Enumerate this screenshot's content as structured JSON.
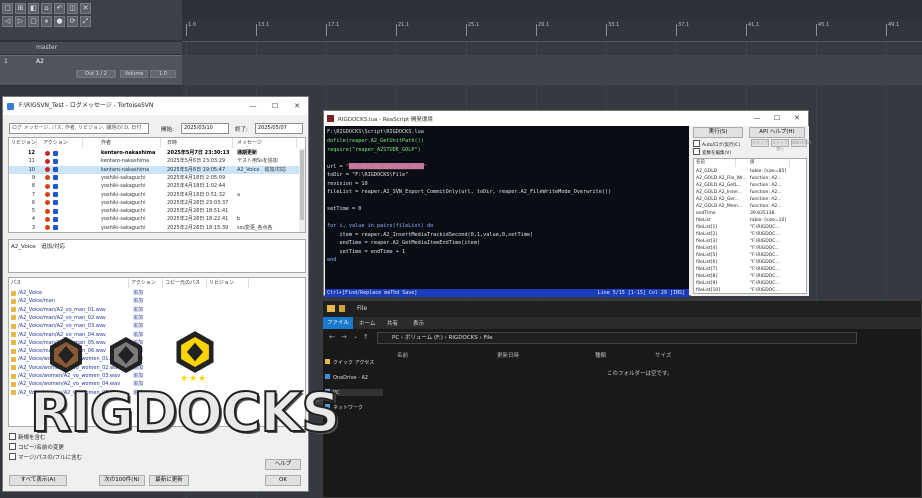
{
  "reaper": {
    "master_label": "master",
    "track_name": "A2",
    "track_btns": [
      "Out 1 / 2",
      "Volume",
      "1.0"
    ],
    "ruler_labels": [
      "1.0",
      "13.1",
      "17.1",
      "21.1",
      "25.1",
      "29.1",
      "33.1",
      "37.1",
      "41.1",
      "45.1",
      "49.1"
    ]
  },
  "tortoise": {
    "title": "F:\\RIGSVN_Test - ログメッセージ - TortoiseSVN",
    "search_placeholder": "ログ メッセージ, パス, 作者, リビジョン, 課題のI D, 日付",
    "from_label": "開始:",
    "from_date": "2025/03/10",
    "to_label": "終了:",
    "to_date": "2025/05/07",
    "columns": [
      "リビジョン",
      "アクション",
      "作者",
      "日時",
      "メッセージ"
    ],
    "rows": [
      {
        "rev": "12",
        "author": "kentaro-nakashima",
        "date": "2025年5月7日 23:30:13",
        "msg": "通期更新",
        "bold": true,
        "sel": false
      },
      {
        "rev": "11",
        "author": "kentaro-nakashima",
        "date": "2025年5月6日 23:03:29",
        "msg": "テスト用Ssを追加",
        "bold": false,
        "sel": false
      },
      {
        "rev": "10",
        "author": "kentaro-nakashima",
        "date": "2025年5月6日 19:05:47",
        "msg": "A2_Voice　追加/対応",
        "bold": false,
        "sel": true
      },
      {
        "rev": "9",
        "author": "yoshiki-sakaguchi",
        "date": "2025年4月18日 2:05:09",
        "msg": "",
        "bold": false,
        "sel": false
      },
      {
        "rev": "8",
        "author": "yoshiki-sakaguchi",
        "date": "2025年4月18日 1:02:44",
        "msg": "",
        "bold": false,
        "sel": false
      },
      {
        "rev": "7",
        "author": "yoshiki-sakaguchi",
        "date": "2025年4月18日 0:51:32",
        "msg": "a",
        "bold": false,
        "sel": false
      },
      {
        "rev": "6",
        "author": "yoshiki-sakaguchi",
        "date": "2025年2月28日 23:03:37",
        "msg": "",
        "bold": false,
        "sel": false
      },
      {
        "rev": "5",
        "author": "yoshiki-sakaguchi",
        "date": "2025年2月28日 18:51:41",
        "msg": "",
        "bold": false,
        "sel": false
      },
      {
        "rev": "4",
        "author": "yoshiki-sakaguchi",
        "date": "2025年2月28日 18:22:41",
        "msg": "b",
        "bold": false,
        "sel": false
      },
      {
        "rev": "3",
        "author": "yoshiki-sakaguchi",
        "date": "2025年2月28日 18:15:39",
        "msg": "sss変更_各点各",
        "bold": false,
        "sel": false
      }
    ],
    "message_text": "A2_Voice　追加/対応",
    "path_columns": [
      "パス",
      "アクション",
      "コピー元のパス",
      "リビジョン"
    ],
    "paths": [
      {
        "p": "/A2_Voice",
        "a": "追加"
      },
      {
        "p": "/A2_Voice/man",
        "a": "追加"
      },
      {
        "p": "/A2_Voice/man/A2_vo_man_01.wav",
        "a": "追加"
      },
      {
        "p": "/A2_Voice/man/A2_vo_man_02.wav",
        "a": "追加"
      },
      {
        "p": "/A2_Voice/man/A2_vo_man_03.wav",
        "a": "追加"
      },
      {
        "p": "/A2_Voice/man/A2_vo_man_04.wav",
        "a": "追加"
      },
      {
        "p": "/A2_Voice/man/A2_vo_man_05.wav",
        "a": "追加"
      },
      {
        "p": "/A2_Voice/man/A2_vo_man_06.wav",
        "a": "追加"
      },
      {
        "p": "/A2_Voice/women/A2_vo_women_01.wav",
        "a": "追加"
      },
      {
        "p": "/A2_Voice/women/A2_vo_women_02.wav",
        "a": "追加"
      },
      {
        "p": "/A2_Voice/women/A2_vo_women_03.wav",
        "a": "追加"
      },
      {
        "p": "/A2_Voice/women/A2_vo_women_04.wav",
        "a": "追加"
      },
      {
        "p": "/A2_Voice/women/A2_vo_women_05.wav",
        "a": "追加"
      }
    ],
    "checks": [
      "新規を含む",
      "コピー/名前の変更",
      "マージ/パスの/フルに含む"
    ],
    "help_btn": "ヘルプ",
    "bottom_btns": [
      "すべて表示(A)",
      "次の100件(N)",
      "最新に更新",
      "OK"
    ]
  },
  "reascript": {
    "title": "RIGDOCKS.lua - ReaScript 開発環境",
    "path_line": "F:\\RIGDOCKS\\Script\\RIGDOCKS.lua",
    "code": [
      [
        {
          "t": "dofile(reaper.A2_GetUnitPath())",
          "c": "#7fe07f"
        }
      ],
      [
        {
          "t": "require(\"reaper_A2STUDE_GOLP\")",
          "c": "#7fe07f"
        }
      ],
      [
        {
          "t": "",
          "c": "#fff"
        }
      ],
      [
        {
          "t": "url = ",
          "c": "#e0e0e0"
        },
        {
          "t": "\"████████████████████████\"",
          "c": "#c77a9a"
        }
      ],
      [
        {
          "t": "toDir = \"F:\\RIGDOCKS\\File\"",
          "c": "#e0e0e0"
        }
      ],
      [
        {
          "t": "revision = 10",
          "c": "#e0e0e0"
        }
      ],
      [
        {
          "t": "fileList = reaper.A2_SVN_Export_CommitOnly(url, toDir, reaper.A2_FileWriteMode_Overwrite())",
          "c": "#e0e0e0"
        }
      ],
      [
        {
          "t": "",
          "c": "#fff"
        }
      ],
      [
        {
          "t": "setTime = 0",
          "c": "#e0e0e0"
        }
      ],
      [
        {
          "t": "",
          "c": "#fff"
        }
      ],
      [
        {
          "t": "for i, value in pairs(fileList) do",
          "c": "#8fb0ff"
        }
      ],
      [
        {
          "t": "    item = reaper.A2_InsertMediaTrackidSecond(0,1,value,0,setTime)",
          "c": "#e0e0e0"
        }
      ],
      [
        {
          "t": "    endTime = reaper.A2_GetMediaItemEndTime(item)",
          "c": "#e0e0e0"
        }
      ],
      [
        {
          "t": "    setTime = endTime + 1",
          "c": "#e0e0e0"
        }
      ],
      [
        {
          "t": "end",
          "c": "#8fb0ff"
        }
      ]
    ],
    "status_left": "Ctrl+[Find/Replace meThd Save]",
    "status_right": "Line 5/15 [1-15] Col 29 [INS]",
    "side_btns": [
      "実行(S)",
      "API ヘルプ(H)"
    ],
    "side_checks": [
      "Auto/ログ/実行(C)",
      "変数を編集(V)"
    ],
    "side_small": [
      "ステップ",
      "ステップ実行",
      "Watch(W)"
    ],
    "var_header": [
      "名前",
      "値"
    ],
    "vars": [
      [
        "A2_GOLD",
        "table: [size=85]"
      ],
      [
        "A2_GOLD A2_File_Wr...",
        "function: A2..."
      ],
      [
        "A2_GOLD A2_GetL...",
        "function: A2..."
      ],
      [
        "A2_GOLD A2_Inser...",
        "function: A2..."
      ],
      [
        "A2_GOLD A2_Ger...",
        "function: A2..."
      ],
      [
        "A2_GOLD A2_Mem...",
        "function: A2..."
      ],
      [
        "endTime",
        "39.835138"
      ],
      [
        "fileList",
        "table: [size=10]"
      ],
      [
        "fileList[1]",
        "\"F:\\RIGDOC..."
      ],
      [
        "fileList[2]",
        "\"F:\\RIGDOC..."
      ],
      [
        "fileList[3]",
        "\"F:\\RIGDOC..."
      ],
      [
        "fileList[4]",
        "\"F:\\RIGDOC..."
      ],
      [
        "fileList[5]",
        "\"F:\\RIGDOC..."
      ],
      [
        "fileList[6]",
        "\"F:\\RIGDOC..."
      ],
      [
        "fileList[7]",
        "\"F:\\RIGDOC..."
      ],
      [
        "fileList[8]",
        "\"F:\\RIGDOC..."
      ],
      [
        "fileList[9]",
        "\"F:\\RIGDOC..."
      ],
      [
        "fileList[10]",
        "\"F:\\RIGDOC..."
      ]
    ]
  },
  "explorer": {
    "title": "File",
    "tabs": [
      "ファイル",
      "ホーム",
      "共有",
      "表示"
    ],
    "crumbs": [
      "PC",
      "ボリューム (F:)",
      "RIGDOCKS",
      "File"
    ],
    "nav": [
      "クイック アクセス",
      "OneDrive - A2",
      "PC",
      "ネットワーク"
    ],
    "columns": [
      "名前",
      "更新日時",
      "種類",
      "サイズ"
    ],
    "empty_msg": "このフォルダーは空です。"
  },
  "logo": {
    "text": "RIGDOCKS"
  },
  "colors": {
    "accent": "#ffd400",
    "svn_sel": "#cce4f7",
    "editor_bg": "#0a0e14",
    "status_bg": "#1a3cbb"
  }
}
